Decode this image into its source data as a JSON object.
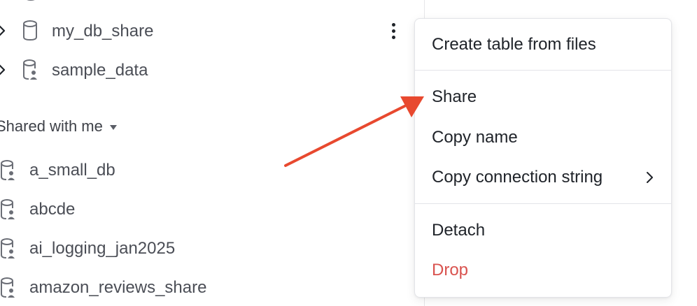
{
  "sidebar": {
    "my_databases": [
      {
        "label": "my_db_share",
        "icon": "database-icon"
      },
      {
        "label": "sample_data",
        "icon": "shared-database-icon"
      }
    ],
    "shared_section_title": "Shared with me",
    "shared_databases": [
      {
        "label": "a_small_db",
        "icon": "shared-database-icon"
      },
      {
        "label": "abcde",
        "icon": "shared-database-icon"
      },
      {
        "label": "ai_logging_jan2025",
        "icon": "shared-database-icon"
      },
      {
        "label": "amazon_reviews_share",
        "icon": "shared-database-icon"
      }
    ]
  },
  "context_menu": {
    "create_table": "Create table from files",
    "share": "Share",
    "copy_name": "Copy name",
    "copy_connection_string": "Copy connection string",
    "detach": "Detach",
    "drop": "Drop"
  },
  "colors": {
    "danger": "#d9534f",
    "annotation_arrow": "#e8492f"
  }
}
